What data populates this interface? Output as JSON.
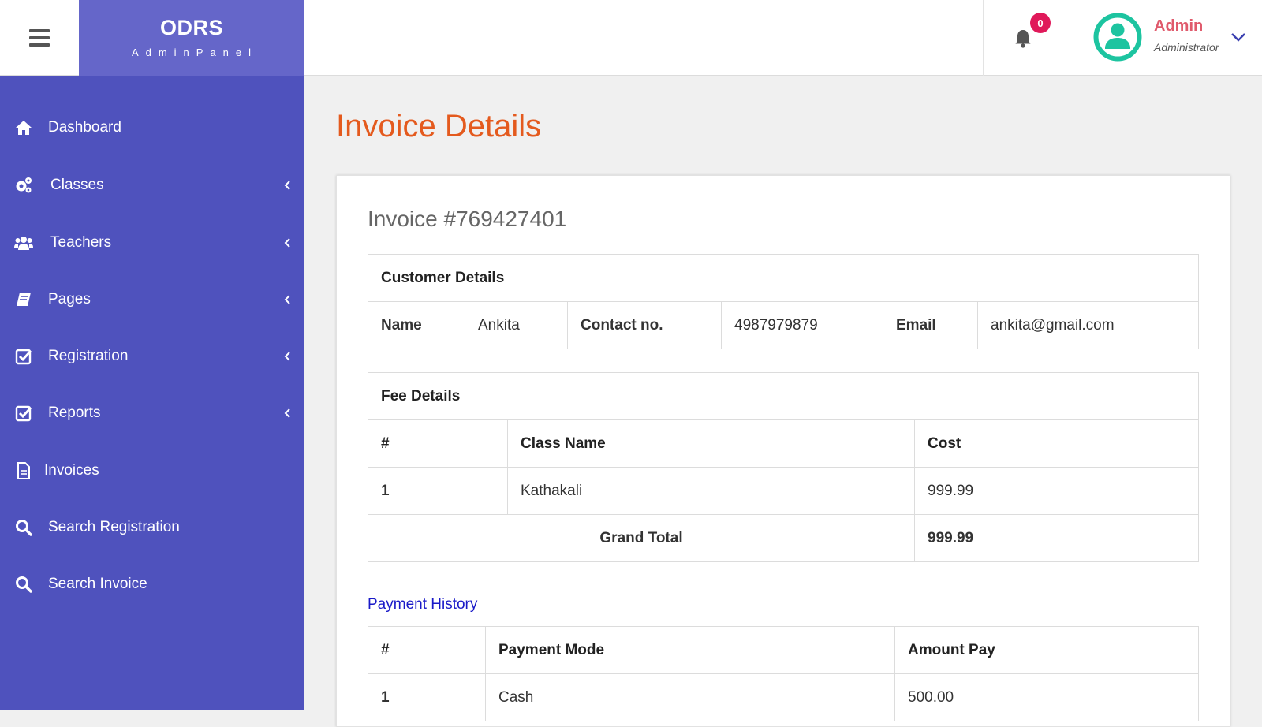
{
  "brand": {
    "name": "ODRS",
    "subtitle": "AdminPanel"
  },
  "notifications": {
    "count": "0"
  },
  "user": {
    "name": "Admin",
    "role": "Administrator"
  },
  "colors": {
    "sidebar": "#4f52bd",
    "brand": "#6566c9",
    "title": "#e45a1e",
    "badge": "#e0195a",
    "avatar": "#1dc4a0",
    "link": "#1a1ac8"
  },
  "sidebar": {
    "items": [
      {
        "label": "Dashboard",
        "icon": "home-icon",
        "has_submenu": false
      },
      {
        "label": "Classes",
        "icon": "cogs-icon",
        "has_submenu": true
      },
      {
        "label": "Teachers",
        "icon": "users-icon",
        "has_submenu": true
      },
      {
        "label": "Pages",
        "icon": "book-icon",
        "has_submenu": true
      },
      {
        "label": "Registration",
        "icon": "check-square-icon",
        "has_submenu": true
      },
      {
        "label": "Reports",
        "icon": "check-square-icon",
        "has_submenu": true
      },
      {
        "label": "Invoices",
        "icon": "file-icon",
        "has_submenu": false
      },
      {
        "label": "Search Registration",
        "icon": "search-icon",
        "has_submenu": false
      },
      {
        "label": "Search Invoice",
        "icon": "search-icon",
        "has_submenu": false
      }
    ]
  },
  "main": {
    "page_title": "Invoice Details",
    "invoice_number": "Invoice #769427401",
    "customer": {
      "section_title": "Customer Details",
      "name_label": "Name",
      "name_value": "Ankita",
      "contact_label": "Contact no.",
      "contact_value": "4987979879",
      "email_label": "Email",
      "email_value": "ankita@gmail.com"
    },
    "fees": {
      "section_title": "Fee Details",
      "headers": [
        "#",
        "Class Name",
        "Cost"
      ],
      "rows": [
        {
          "num": "1",
          "class_name": "Kathakali",
          "cost": "999.99"
        }
      ],
      "grand_total_label": "Grand Total",
      "grand_total_value": "999.99"
    },
    "payment": {
      "title": "Payment History",
      "headers": [
        "#",
        "Payment Mode",
        "Amount Pay"
      ],
      "rows": [
        {
          "num": "1",
          "mode": "Cash",
          "amount": "500.00"
        }
      ]
    }
  }
}
